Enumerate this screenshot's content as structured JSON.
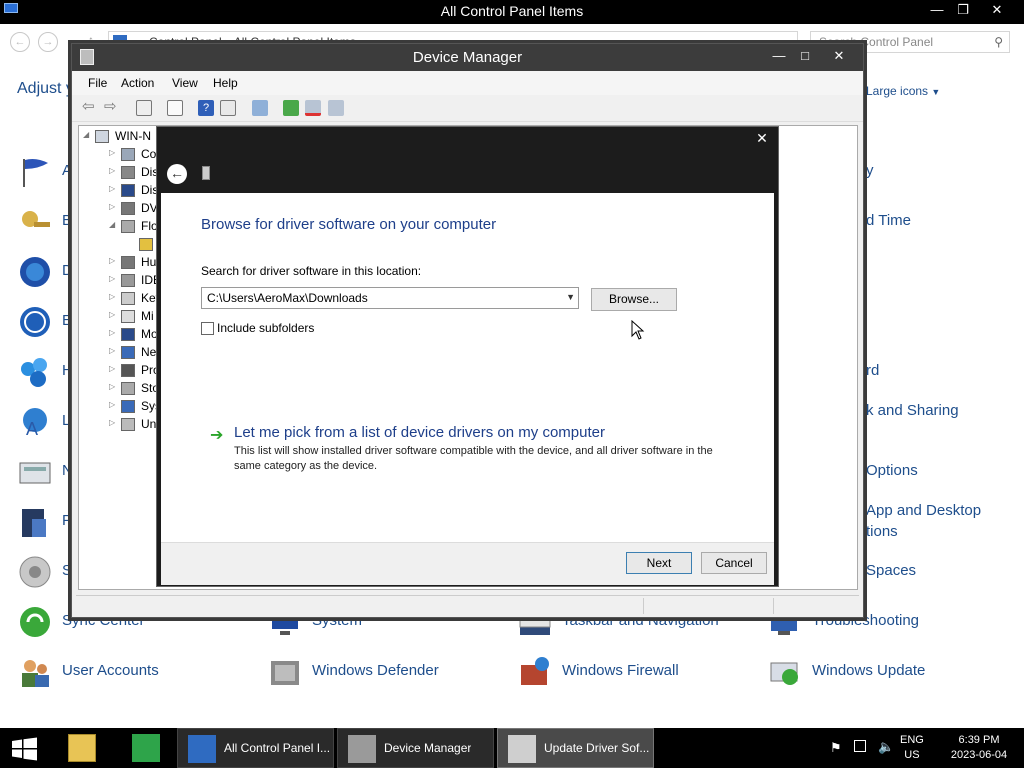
{
  "control_panel": {
    "window_title": "All Control Panel Items",
    "address_segments": [
      "Control Panel",
      "All Control Panel Items"
    ],
    "search_placeholder": "Search Control Panel",
    "heading": "Adjust y",
    "view_by": "Large icons",
    "items": [
      {
        "label": "A",
        "icon": "action-center-flag-icon"
      },
      {
        "label": "B",
        "icon": "bitlocker-key-icon"
      },
      {
        "label": "D",
        "icon": "default-programs-icon"
      },
      {
        "label": "E",
        "icon": "ease-of-access-icon"
      },
      {
        "label": "H",
        "icon": "homegroup-icon"
      },
      {
        "label": "L",
        "icon": "language-icon"
      },
      {
        "label": "N",
        "icon": "network-icon"
      },
      {
        "label": "P",
        "icon": "phone-modem-icon"
      },
      {
        "label": "S",
        "icon": "sound-icon"
      },
      {
        "label": "Sync Center",
        "icon": "sync-center-icon"
      },
      {
        "label": "User Accounts",
        "icon": "user-accounts-icon"
      },
      {
        "label": "System",
        "icon": "system-icon"
      },
      {
        "label": "Windows Defender",
        "icon": "windows-defender-icon"
      },
      {
        "label": "Taskbar and Navigation",
        "icon": "taskbar-icon"
      },
      {
        "label": "Windows Firewall",
        "icon": "windows-firewall-icon"
      },
      {
        "label": "Troubleshooting",
        "icon": "troubleshooting-icon"
      },
      {
        "label": "Windows Update",
        "icon": "windows-update-icon"
      },
      {
        "label": "y",
        "icon": ""
      },
      {
        "label": "d Time",
        "icon": ""
      },
      {
        "label": "rd",
        "icon": ""
      },
      {
        "label": "k and Sharing",
        "icon": ""
      },
      {
        "label": "Options",
        "icon": ""
      },
      {
        "label": "App and Desktop",
        "icon": ""
      },
      {
        "label": "tions",
        "icon": ""
      },
      {
        "label": "Spaces",
        "icon": ""
      }
    ]
  },
  "device_manager": {
    "window_title": "Device Manager",
    "menu": [
      "File",
      "Action",
      "View",
      "Help"
    ],
    "tree_root": "WIN-N",
    "tree": [
      "Co",
      "Dis",
      "Dis",
      "DV",
      "Flo",
      "",
      "Hu",
      "IDE",
      "Key",
      "Mi",
      "Mo",
      "Ne",
      "Pro",
      "Sto",
      "Sys",
      "Un"
    ]
  },
  "dialog": {
    "heading": "Browse for driver software on your computer",
    "search_label": "Search for driver software in this location:",
    "path_value": "C:\\Users\\AeroMax\\Downloads",
    "browse_label": "Browse...",
    "include_subfolders_label": "Include subfolders",
    "include_subfolders_checked": false,
    "pick_title": "Let me pick from a list of device drivers on my computer",
    "pick_description": "This list will show installed driver software compatible with the device, and all driver software in the same category as the device.",
    "next_label": "Next",
    "cancel_label": "Cancel"
  },
  "taskbar": {
    "items": [
      {
        "label": "All Control Panel I...",
        "icon": "control-panel-icon"
      },
      {
        "label": "Device Manager",
        "icon": "device-manager-icon"
      },
      {
        "label": "Update Driver Sof...",
        "icon": "update-driver-icon"
      }
    ],
    "lang_top": "ENG",
    "lang_bottom": "US",
    "time": "6:39 PM",
    "date": "2023-06-04"
  },
  "colors": {
    "title_link_blue": "#1e4e8c",
    "dialog_heading_blue": "#1e3f8a",
    "taskbar_bg": "#000000",
    "pick_arrow_green": "#2aa52a"
  }
}
